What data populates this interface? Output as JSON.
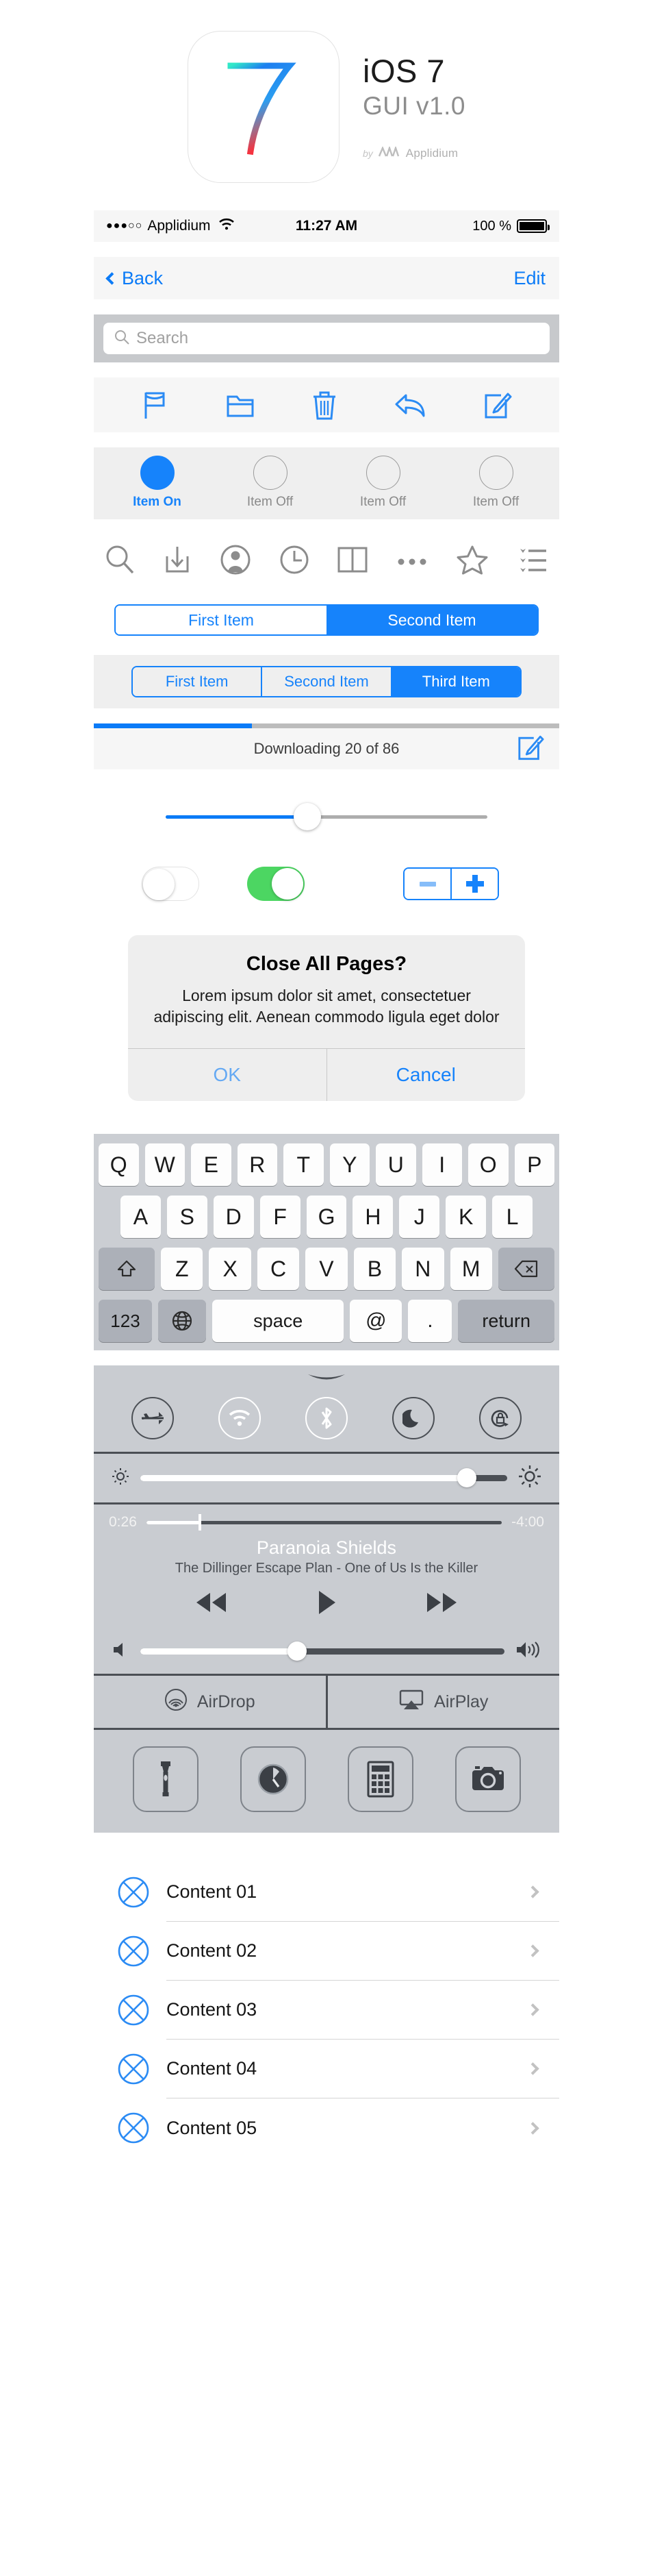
{
  "header": {
    "icon_name": "ios7-app-icon",
    "title": "iOS 7",
    "subtitle": "GUI v1.0",
    "by_label": "by",
    "brand": "Applidium",
    "accent": "#0b7bf7"
  },
  "status_bar": {
    "signal_dots": "●●●○○",
    "carrier": "Applidium",
    "wifi_icon": "wifi-icon",
    "time": "11:27 AM",
    "battery_percent": "100 %",
    "battery_icon": "battery-full-icon"
  },
  "nav_bar": {
    "back_label": "Back",
    "back_icon": "chevron-left-icon",
    "edit_label": "Edit"
  },
  "search": {
    "placeholder": "Search",
    "icon": "search-icon",
    "value": ""
  },
  "toolbar": {
    "items": [
      {
        "icon": "flag-icon",
        "label": "Flag"
      },
      {
        "icon": "folder-icon",
        "label": "Folder"
      },
      {
        "icon": "trash-icon",
        "label": "Trash"
      },
      {
        "icon": "reply-icon",
        "label": "Reply"
      },
      {
        "icon": "compose-icon",
        "label": "Compose"
      }
    ]
  },
  "radio_row": {
    "items": [
      {
        "label": "Item On",
        "selected": true
      },
      {
        "label": "Item Off",
        "selected": false
      },
      {
        "label": "Item Off",
        "selected": false
      },
      {
        "label": "Item Off",
        "selected": false
      }
    ]
  },
  "icon_row": {
    "items": [
      {
        "icon": "search-icon"
      },
      {
        "icon": "download-icon"
      },
      {
        "icon": "contact-icon"
      },
      {
        "icon": "clock-icon"
      },
      {
        "icon": "book-icon"
      },
      {
        "icon": "ellipsis-icon"
      },
      {
        "icon": "star-icon"
      },
      {
        "icon": "bookmark-list-icon"
      }
    ]
  },
  "segmented_two": {
    "options": [
      "First Item",
      "Second Item"
    ],
    "selected_index": 1
  },
  "segmented_three": {
    "options": [
      "First Item",
      "Second Item",
      "Third Item"
    ],
    "selected_index": 2
  },
  "progress": {
    "status_text": "Downloading 20 of 86",
    "percent": 34,
    "compose_icon": "compose-icon"
  },
  "slider": {
    "value_percent": 44
  },
  "switches": {
    "off_state_label": "off",
    "on_state_label": "on",
    "on_color": "#4cd662"
  },
  "stepper": {
    "minus_icon": "minus-icon",
    "plus_icon": "plus-icon"
  },
  "alert": {
    "title": "Close All Pages?",
    "message": "Lorem ipsum dolor sit amet, consectetuer adipiscing elit. Aenean commodo ligula eget dolor",
    "ok_label": "OK",
    "cancel_label": "Cancel"
  },
  "keyboard": {
    "row1": [
      "Q",
      "W",
      "E",
      "R",
      "T",
      "Y",
      "U",
      "I",
      "O",
      "P"
    ],
    "row2": [
      "A",
      "S",
      "D",
      "F",
      "G",
      "H",
      "J",
      "K",
      "L"
    ],
    "row3": [
      "Z",
      "X",
      "C",
      "V",
      "B",
      "N",
      "M"
    ],
    "shift_icon": "shift-icon",
    "delete_icon": "delete-icon",
    "numbers_label": "123",
    "globe_icon": "globe-icon",
    "space_label": "space",
    "at_label": "@",
    "dot_label": ".",
    "return_label": "return"
  },
  "control_center": {
    "grabber_icon": "grabber-icon",
    "toggles": [
      {
        "icon": "airplane-icon",
        "label": "Airplane Mode",
        "active": false
      },
      {
        "icon": "wifi-icon",
        "label": "Wi-Fi",
        "active": true
      },
      {
        "icon": "bluetooth-icon",
        "label": "Bluetooth",
        "active": true
      },
      {
        "icon": "moon-icon",
        "label": "Do Not Disturb",
        "active": false
      },
      {
        "icon": "rotation-lock-icon",
        "label": "Rotation Lock",
        "active": false
      }
    ],
    "brightness": {
      "low_icon": "brightness-low-icon",
      "high_icon": "brightness-high-icon",
      "value_percent": 89
    },
    "music": {
      "elapsed": "0:26",
      "remaining": "-4:00",
      "progress_percent": 15,
      "title": "Paranoia Shields",
      "subtitle": "The Dillinger Escape Plan - One of Us Is the Killer",
      "prev_icon": "rewind-icon",
      "play_icon": "play-icon",
      "next_icon": "fast-forward-icon"
    },
    "volume": {
      "low_icon": "volume-low-icon",
      "high_icon": "volume-high-icon",
      "value_percent": 43
    },
    "airdrop": {
      "label": "AirDrop",
      "icon": "airdrop-icon"
    },
    "airplay": {
      "label": "AirPlay",
      "icon": "airplay-icon"
    },
    "shortcuts": [
      {
        "icon": "flashlight-icon",
        "label": "Flashlight"
      },
      {
        "icon": "timer-icon",
        "label": "Timer"
      },
      {
        "icon": "calculator-icon",
        "label": "Calculator"
      },
      {
        "icon": "camera-icon",
        "label": "Camera"
      }
    ]
  },
  "content_list": {
    "rows": [
      {
        "icon": "placeholder-x-circle-icon",
        "label": "Content 01",
        "accessory": "chevron-right-icon"
      },
      {
        "icon": "placeholder-x-circle-icon",
        "label": "Content 02",
        "accessory": "chevron-right-icon"
      },
      {
        "icon": "placeholder-x-circle-icon",
        "label": "Content 03",
        "accessory": "chevron-right-icon"
      },
      {
        "icon": "placeholder-x-circle-icon",
        "label": "Content 04",
        "accessory": "chevron-right-icon"
      },
      {
        "icon": "placeholder-x-circle-icon",
        "label": "Content 05",
        "accessory": "chevron-right-icon"
      }
    ]
  }
}
